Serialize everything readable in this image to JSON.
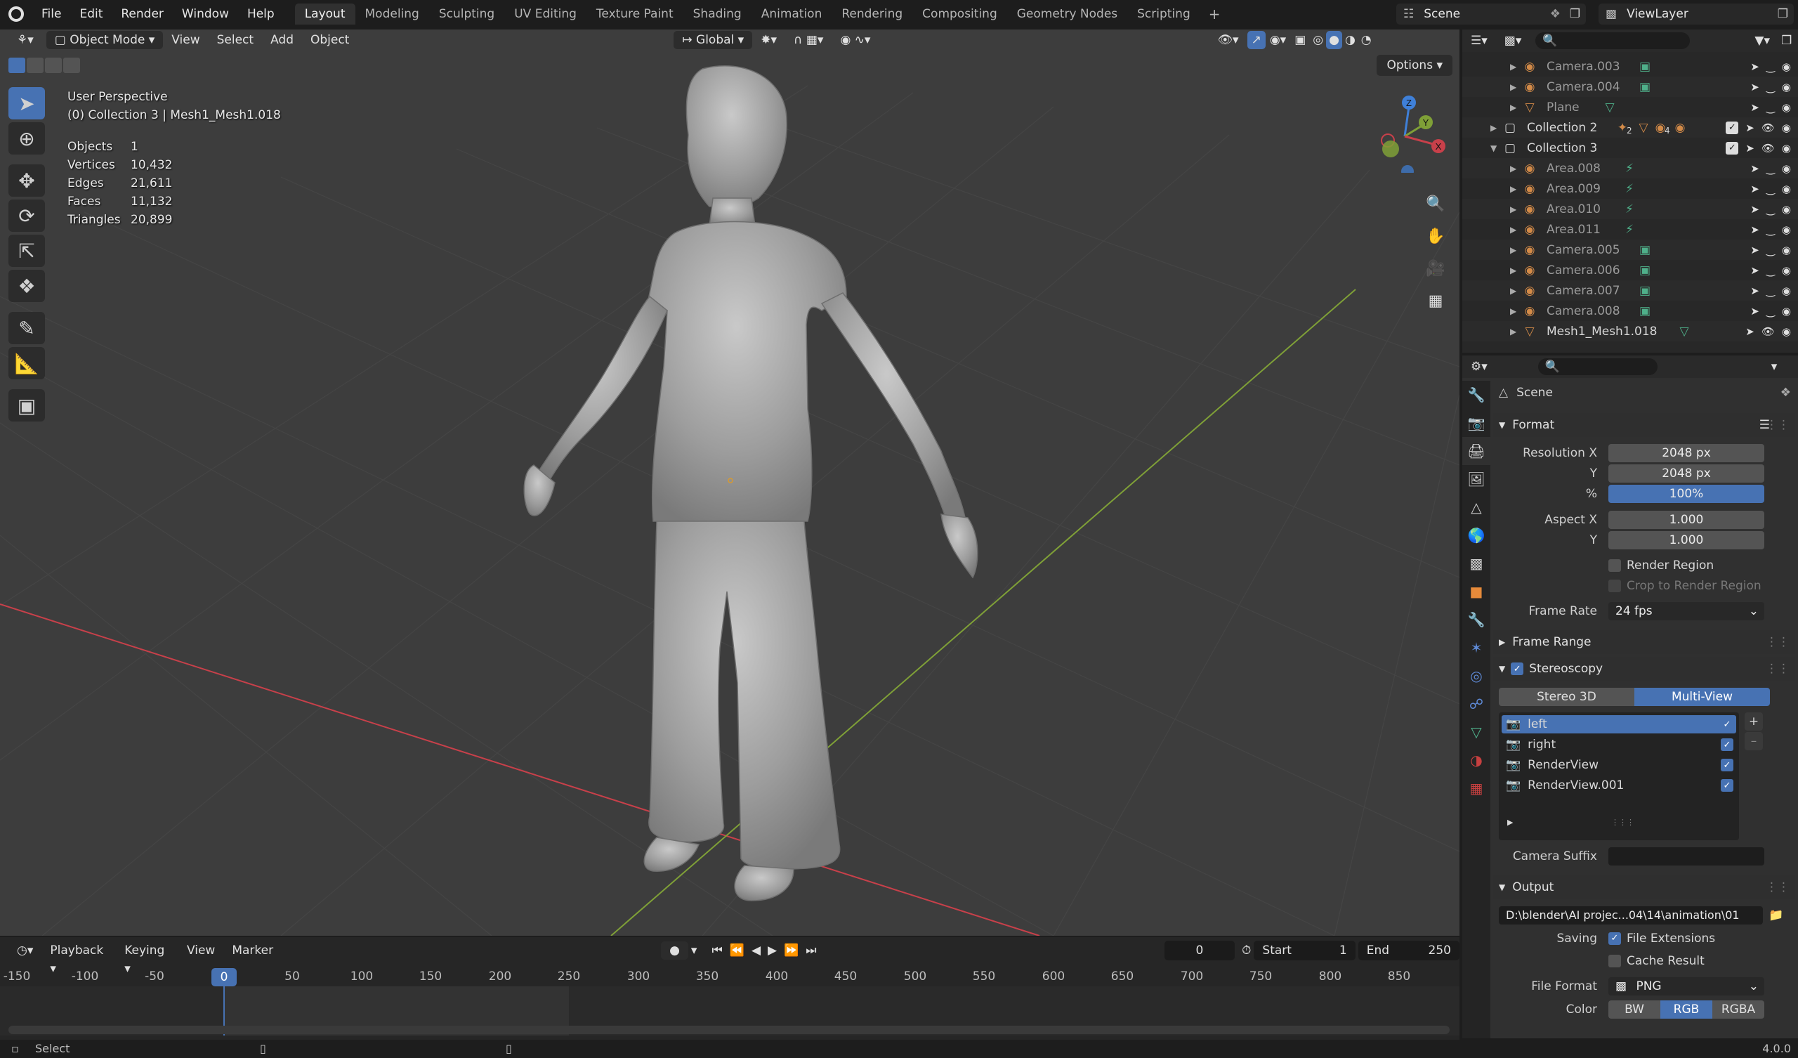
{
  "topbar": {
    "menus": [
      "File",
      "Edit",
      "Render",
      "Window",
      "Help"
    ],
    "workspaces": [
      "Layout",
      "Modeling",
      "Sculpting",
      "UV Editing",
      "Texture Paint",
      "Shading",
      "Animation",
      "Rendering",
      "Compositing",
      "Geometry Nodes",
      "Scripting"
    ],
    "active_workspace": "Layout",
    "scene": "Scene",
    "view_layer": "ViewLayer"
  },
  "viewport": {
    "mode": "Object Mode",
    "menus": [
      "View",
      "Select",
      "Add",
      "Object"
    ],
    "orientation": "Global",
    "options": "Options",
    "perspective": "User Perspective",
    "collection_info": "(0) Collection 3 | Mesh1_Mesh1.018",
    "stats": [
      {
        "label": "Objects",
        "value": "1"
      },
      {
        "label": "Vertices",
        "value": "10,432"
      },
      {
        "label": "Edges",
        "value": "21,611"
      },
      {
        "label": "Faces",
        "value": "11,132"
      },
      {
        "label": "Triangles",
        "value": "20,899"
      }
    ],
    "gizmo": {
      "z": "Z",
      "y": "Y",
      "x": "X"
    }
  },
  "timeline": {
    "menus": [
      "Playback",
      "Keying",
      "View",
      "Marker"
    ],
    "current_frame": "0",
    "start_label": "Start",
    "start": "1",
    "end_label": "End",
    "end": "250",
    "ticks": [
      "-150",
      "-100",
      "-50",
      "0",
      "50",
      "100",
      "150",
      "200",
      "250",
      "300",
      "350",
      "400",
      "450",
      "500",
      "550",
      "600",
      "650",
      "700",
      "750",
      "800",
      "850"
    ],
    "playhead": "0"
  },
  "statusbar": {
    "left": "Select",
    "version": "4.0.0"
  },
  "outliner": {
    "rows": [
      {
        "name": "Camera.003",
        "type": "camera",
        "level": 2
      },
      {
        "name": "Camera.004",
        "type": "camera",
        "level": 2
      },
      {
        "name": "Plane",
        "type": "mesh",
        "level": 2
      },
      {
        "name": "Collection 2",
        "type": "collection",
        "level": 1
      },
      {
        "name": "Collection 3",
        "type": "collection",
        "level": 1
      },
      {
        "name": "Area.008",
        "type": "light",
        "level": 2
      },
      {
        "name": "Area.009",
        "type": "light",
        "level": 2
      },
      {
        "name": "Area.010",
        "type": "light",
        "level": 2
      },
      {
        "name": "Area.011",
        "type": "light",
        "level": 2
      },
      {
        "name": "Camera.005",
        "type": "camera",
        "level": 2
      },
      {
        "name": "Camera.006",
        "type": "camera",
        "level": 2
      },
      {
        "name": "Camera.007",
        "type": "camera",
        "level": 2
      },
      {
        "name": "Camera.008",
        "type": "camera",
        "level": 2
      },
      {
        "name": "Mesh1_Mesh1.018",
        "type": "mesh",
        "level": 2
      }
    ],
    "collection2_badges": [
      "2",
      "4"
    ]
  },
  "properties": {
    "context": "Scene",
    "format": {
      "title": "Format",
      "res_x_label": "Resolution X",
      "res_x": "2048 px",
      "res_y_label": "Y",
      "res_y": "2048 px",
      "pct_label": "%",
      "pct": "100%",
      "aspect_x_label": "Aspect X",
      "aspect_x": "1.000",
      "aspect_y_label": "Y",
      "aspect_y": "1.000",
      "render_region": "Render Region",
      "crop": "Crop to Render Region",
      "frame_rate_label": "Frame Rate",
      "frame_rate": "24 fps"
    },
    "frame_range": "Frame Range",
    "stereoscopy": {
      "title": "Stereoscopy",
      "mode_a": "Stereo 3D",
      "mode_b": "Multi-View",
      "views": [
        "left",
        "right",
        "RenderView",
        "RenderView.001"
      ],
      "camera_suffix_label": "Camera Suffix",
      "camera_suffix": ""
    },
    "output": {
      "title": "Output",
      "path": "D:\\blender\\AI projec...04\\14\\animation\\01",
      "saving_label": "Saving",
      "file_extensions": "File Extensions",
      "cache_result": "Cache Result",
      "file_format_label": "File Format",
      "file_format": "PNG",
      "color_label": "Color",
      "color_options": [
        "BW",
        "RGB",
        "RGBA"
      ],
      "color_selected": "RGB"
    }
  },
  "colors": {
    "accent": "#4772b3",
    "viewport_bg": "#3d3d3d",
    "x_axis": "#c8404a",
    "y_axis": "#7fa037",
    "z_axis": "#3f80d8"
  }
}
